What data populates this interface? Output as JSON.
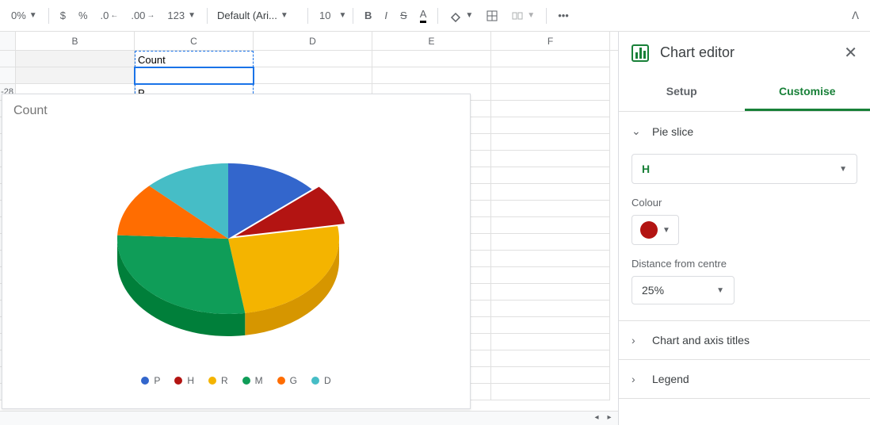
{
  "toolbar": {
    "zoom": "0%",
    "currency": "$",
    "percent": "%",
    "dec_dec": ".0",
    "inc_dec": ".00",
    "more_formats": "123",
    "font": "Default (Ari...",
    "font_size": "10",
    "bold": "B",
    "italic": "I",
    "strike": "S",
    "text_color": "A",
    "more": "•••"
  },
  "columns": [
    "B",
    "C",
    "D",
    "E",
    "F"
  ],
  "cells": {
    "c_row2": "Count",
    "c_row4": "P",
    "a_row3": "-28"
  },
  "chart_data": {
    "type": "pie",
    "title": "Count",
    "series": [
      {
        "name": "P",
        "value": 28,
        "color": "#3366cc"
      },
      {
        "name": "H",
        "value": 18,
        "color": "#b31412",
        "explode": 0.25
      },
      {
        "name": "R",
        "value": 52,
        "color": "#f4b400"
      },
      {
        "name": "M",
        "value": 58,
        "color": "#0f9d58"
      },
      {
        "name": "G",
        "value": 24,
        "color": "#ff6d01"
      },
      {
        "name": "D",
        "value": 26,
        "color": "#46bdc6"
      }
    ]
  },
  "editor": {
    "title": "Chart editor",
    "tabs": {
      "setup": "Setup",
      "customise": "Customise"
    },
    "pie_slice": {
      "section": "Pie slice",
      "selected": "H",
      "colour_label": "Colour",
      "colour_value": "#b31412",
      "distance_label": "Distance from centre",
      "distance_value": "25%"
    },
    "titles_section": "Chart and axis titles",
    "legend_section": "Legend"
  }
}
